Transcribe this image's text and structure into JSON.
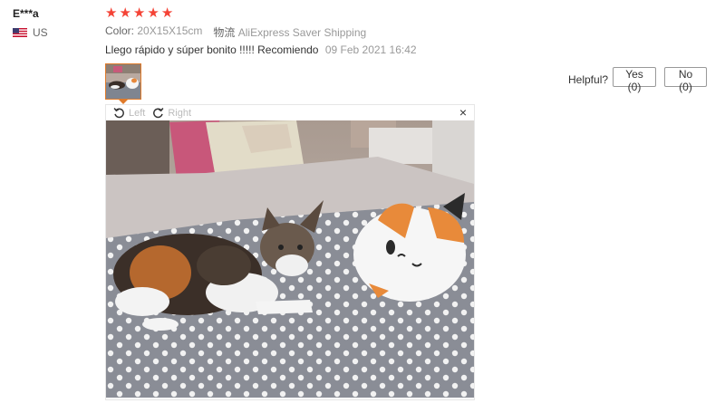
{
  "review": {
    "reviewer_name": "E***a",
    "country": "US",
    "rating": 5,
    "attributes": [
      {
        "key": "Color:",
        "value": "20X15X15cm"
      },
      {
        "key": "物流",
        "value": "AliExpress Saver Shipping"
      }
    ],
    "feedback_text": "Llego rápido y súper bonito !!!!! Recomiendo",
    "date": "09 Feb 2021 16:42",
    "helpful_label": "Helpful?",
    "yes_label": "Yes (0)",
    "no_label": "No (0)"
  },
  "viewer": {
    "rotate_left_label": "Left",
    "rotate_right_label": "Right",
    "close_glyph": "×"
  },
  "icons": [
    "us-flag-icon",
    "star-icon",
    "rotate-left-icon",
    "rotate-right-icon",
    "close-icon"
  ],
  "colors": {
    "star": "#f44336",
    "thumb_border": "#e07b2a"
  }
}
